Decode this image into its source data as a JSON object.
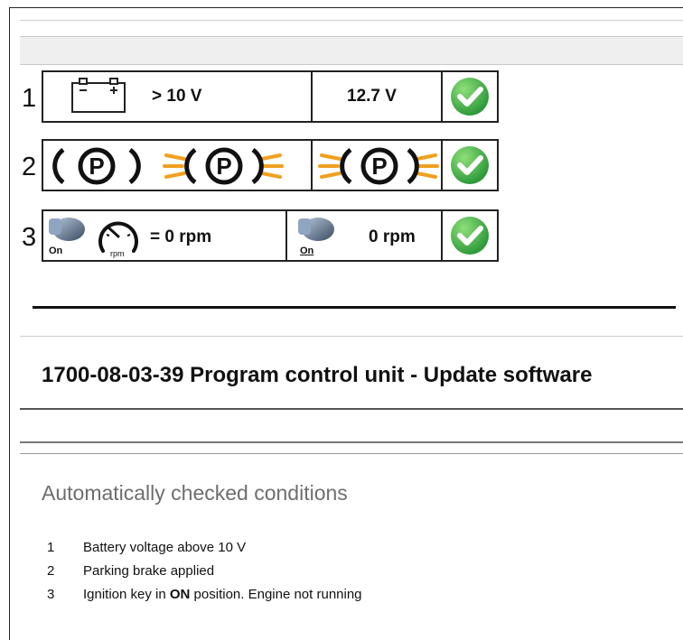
{
  "conditions": [
    {
      "number": "1",
      "requirement": "> 10 V",
      "actual": "12.7 V",
      "status": "ok",
      "icon": "battery-icon"
    },
    {
      "number": "2",
      "requirement": "",
      "actual": "",
      "status": "ok",
      "icon": "parking-brake-icon"
    },
    {
      "number": "3",
      "requirement": "= 0 rpm",
      "actual": "0 rpm",
      "status": "ok",
      "icon": "ignition-key-icon",
      "key_label": "On",
      "gauge_label": "rpm"
    }
  ],
  "title": "1700-08-03-39 Program control unit - Update software",
  "subtitle": "Automatically checked conditions",
  "list": [
    {
      "number": "1",
      "pre": "Battery voltage above 10 V",
      "bold": "",
      "post": ""
    },
    {
      "number": "2",
      "pre": "Parking brake applied",
      "bold": "",
      "post": ""
    },
    {
      "number": "3",
      "pre": "Ignition key in ",
      "bold": "ON",
      "post": " position. Engine not running"
    }
  ],
  "colors": {
    "check_green": "#3aa845",
    "brake_orange": "#f0a020",
    "divider": "#111111"
  }
}
